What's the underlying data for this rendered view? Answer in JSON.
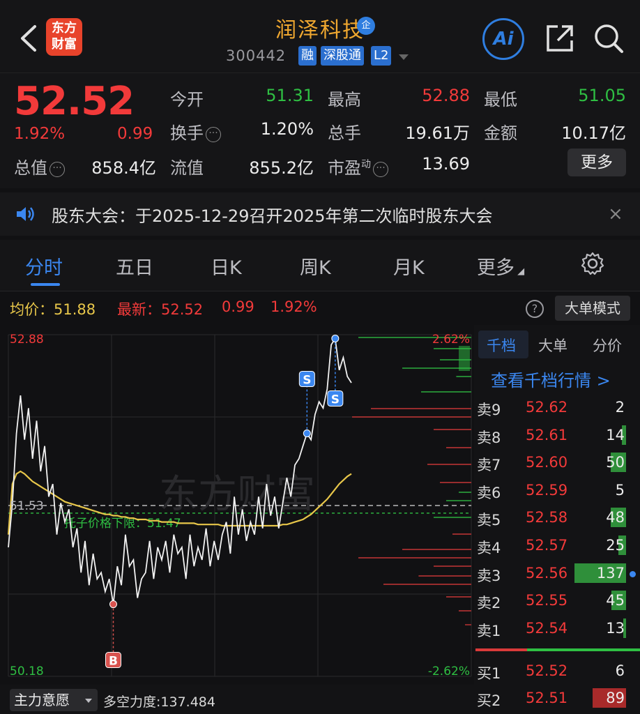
{
  "header": {
    "logo_line1": "东方",
    "logo_line2": "财富",
    "title": "润泽科技",
    "enterprise_badge": "企",
    "code": "300442",
    "tags": [
      "融",
      "深股通",
      "L2"
    ],
    "ai_label": "Ai"
  },
  "quote": {
    "price": "52.52",
    "change_pct": "1.92%",
    "change": "0.99",
    "rows": [
      [
        {
          "label": "今开",
          "value": "51.31",
          "color": "green"
        },
        {
          "label": "最高",
          "value": "52.88",
          "color": "red"
        },
        {
          "label": "最低",
          "value": "51.05",
          "color": "green"
        }
      ],
      [
        {
          "label": "换手",
          "value": "1.20%",
          "color": "white"
        },
        {
          "label": "总手",
          "value": "19.61万",
          "color": "white"
        },
        {
          "label": "金额",
          "value": "10.17亿",
          "color": "white"
        }
      ]
    ],
    "total_cap_label": "总值",
    "total_cap": "858.4亿",
    "float_cap_label": "流值",
    "float_cap": "855.2亿",
    "pe_label": "市盈",
    "pe_sup": "动",
    "pe": "13.69",
    "more_label": "更多"
  },
  "notice": {
    "text": "股东大会：于2025-12-29召开2025年第二次临时股东大会",
    "close": "×"
  },
  "tabs": [
    "分时",
    "五日",
    "日K",
    "周K",
    "月K",
    "更多"
  ],
  "summary": {
    "avg_label": "均价：",
    "avg_value": "51.88",
    "latest_label": "最新：",
    "latest_price": "52.52",
    "latest_change": "0.99",
    "latest_pct": "1.92%",
    "help": "?",
    "mode_label": "大单模式"
  },
  "chart_data": {
    "type": "line",
    "y_max_label": "52.88",
    "y_min_label": "50.18",
    "pct_max_label": "2.62%",
    "pct_min_label": "-2.62%",
    "ylim": [
      50.18,
      52.88
    ],
    "prev_close_label": "51.53",
    "prev_close": 51.53,
    "support_label": "托子价格下限：51.47",
    "support": 51.47,
    "watermark": "东方财富",
    "series": [
      {
        "name": "最新",
        "values": [
          51.2,
          51.55,
          52.1,
          52.4,
          52.05,
          52.3,
          51.9,
          52.2,
          51.8,
          52.0,
          51.6,
          51.7,
          51.3,
          51.55,
          51.4,
          51.5,
          51.2,
          51.35,
          51.0,
          51.25,
          50.9,
          51.15,
          50.95,
          51.0,
          50.85,
          50.95,
          50.75,
          51.05,
          50.9,
          51.3,
          51.05,
          51.1,
          50.8,
          50.95,
          51.0,
          51.25,
          50.95,
          51.2,
          51.1,
          51.25,
          51.0,
          51.3,
          51.15,
          51.2,
          50.95,
          51.3,
          51.05,
          51.2,
          51.1,
          51.35,
          51.05,
          51.25,
          51.1,
          51.3,
          51.4,
          51.15,
          51.6,
          51.3,
          51.5,
          51.25,
          51.4,
          51.3,
          51.6,
          51.35,
          51.7,
          51.45,
          51.6,
          51.35,
          51.55,
          51.75,
          51.6,
          51.85,
          51.9,
          52.0,
          52.1,
          52.05,
          52.25,
          52.35,
          52.3,
          52.45,
          52.8,
          52.85,
          52.6,
          52.7,
          52.55,
          52.5
        ]
      },
      {
        "name": "均价",
        "values": [
          51.3,
          51.7,
          51.78,
          51.8,
          51.78,
          51.75,
          51.72,
          51.7,
          51.68,
          51.66,
          51.64,
          51.62,
          51.6,
          51.58,
          51.56,
          51.55,
          51.54,
          51.53,
          51.52,
          51.51,
          51.5,
          51.49,
          51.48,
          51.47,
          51.46,
          51.46,
          51.45,
          51.45,
          51.44,
          51.44,
          51.43,
          51.43,
          51.42,
          51.42,
          51.42,
          51.41,
          51.41,
          51.41,
          51.4,
          51.4,
          51.4,
          51.4,
          51.39,
          51.39,
          51.39,
          51.39,
          51.39,
          51.38,
          51.38,
          51.38,
          51.38,
          51.38,
          51.38,
          51.37,
          51.37,
          51.37,
          51.37,
          51.37,
          51.37,
          51.37,
          51.37,
          51.37,
          51.37,
          51.37,
          51.37,
          51.37,
          51.37,
          51.37,
          51.38,
          51.38,
          51.39,
          51.4,
          51.41,
          51.42,
          51.44,
          51.46,
          51.49,
          51.52,
          51.55,
          51.58,
          51.62,
          51.66,
          51.7,
          51.73,
          51.76,
          51.78
        ]
      }
    ],
    "markers": [
      {
        "label": "B",
        "color": "#d9534f"
      },
      {
        "label": "S",
        "color": "#3b87f0"
      },
      {
        "label": "S",
        "color": "#3b87f0"
      }
    ]
  },
  "book": {
    "tabs": [
      "千档",
      "大单",
      "分价"
    ],
    "link": "查看千档行情 >",
    "asks": [
      {
        "label": "卖9",
        "price": "52.62",
        "vol": "2",
        "bar": 0.0
      },
      {
        "label": "卖8",
        "price": "52.61",
        "vol": "14",
        "bar": 0.08
      },
      {
        "label": "卖7",
        "price": "52.60",
        "vol": "50",
        "bar": 0.3
      },
      {
        "label": "卖6",
        "price": "52.59",
        "vol": "5",
        "bar": 0.0
      },
      {
        "label": "卖5",
        "price": "52.58",
        "vol": "48",
        "bar": 0.3
      },
      {
        "label": "卖4",
        "price": "52.57",
        "vol": "25",
        "bar": 0.15
      },
      {
        "label": "卖3",
        "price": "52.56",
        "vol": "137",
        "bar": 1.0
      },
      {
        "label": "卖2",
        "price": "52.55",
        "vol": "45",
        "bar": 0.28
      },
      {
        "label": "卖1",
        "price": "52.54",
        "vol": "13",
        "bar": 0.05
      }
    ],
    "bids": [
      {
        "label": "买1",
        "price": "52.52",
        "vol": "6",
        "bar": 0.0
      },
      {
        "label": "买2",
        "price": "52.51",
        "vol": "89",
        "bar": 0.65
      }
    ]
  },
  "footer": {
    "btn": "主力意愿",
    "text": "多空力度:137.484"
  }
}
